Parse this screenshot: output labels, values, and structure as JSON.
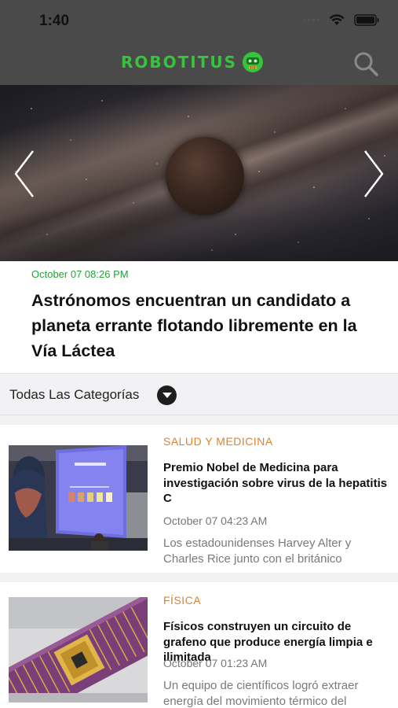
{
  "status_bar": {
    "time": "1:40"
  },
  "header": {
    "logo_text": "ROBOTITUS",
    "logo_icon": "robot-face-icon",
    "search_icon": "search-icon"
  },
  "hero": {
    "prev_icon": "chevron-left-icon",
    "next_icon": "chevron-right-icon",
    "date": "October 07 08:26 PM",
    "title": "Astrónomos encuentran un candidato a planeta errante flotando libremente en la Vía Láctea"
  },
  "categories": {
    "label": "Todas Las Categorías"
  },
  "articles": [
    {
      "category": "SALUD Y MEDICINA",
      "title": "Premio Nobel de Medicina para investigación sobre virus de la hepatitis C",
      "date": "October 07 04:23 AM",
      "excerpt": "Los estadounidenses Harvey Alter y Charles Rice junto con el británico"
    },
    {
      "category": "FÍSICA",
      "title": "Físicos construyen un circuito de grafeno que produce energía limpia e ilimitada",
      "date": "October 07 01:23 AM",
      "excerpt": "Un equipo de científicos logró extraer energía del movimiento térmico del"
    }
  ],
  "colors": {
    "accent_green": "#23a33a",
    "category_orange": "#e0822a",
    "header_bg": "#4a4a4a"
  }
}
